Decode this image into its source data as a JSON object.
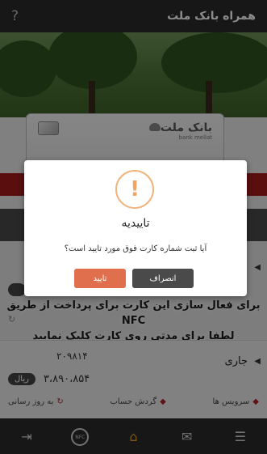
{
  "header": {
    "title": "همراه بانک ملت",
    "help_icon": "?"
  },
  "card": {
    "bank_name": "بانک ملت",
    "bank_name_en": "bank mellat"
  },
  "nfc_message": {
    "line1": "برای فعال سازی این کارت برای پرداخت از طریق NFC",
    "line2": "لطفا برای مدتی روی کارت کلیک نمایید"
  },
  "account": {
    "type": "جاری",
    "number": "۲۰۹۸۱۴",
    "currency": "ریال",
    "balance": "۳،۸۹۰،۸۵۴",
    "actions": [
      "به روز رسانی",
      "گردش حساب",
      "سرویس ها"
    ]
  },
  "dialog": {
    "icon_glyph": "!",
    "title": "تاییدیه",
    "message": "آیا ثبت شماره کارت فوق مورد تایید است؟",
    "confirm_label": "تایید",
    "cancel_label": "انصراف"
  },
  "bottom_nav": {
    "items": [
      {
        "icon": "logout-icon"
      },
      {
        "icon": "nfc-icon",
        "label": "NFC"
      },
      {
        "icon": "home-icon"
      },
      {
        "icon": "mail-icon"
      },
      {
        "icon": "menu-icon"
      }
    ]
  },
  "colors": {
    "accent_red": "#a51a1a",
    "confirm_orange": "#e0704d",
    "cancel_gray": "#4a4a4a",
    "warning_icon": "#f0a561"
  }
}
